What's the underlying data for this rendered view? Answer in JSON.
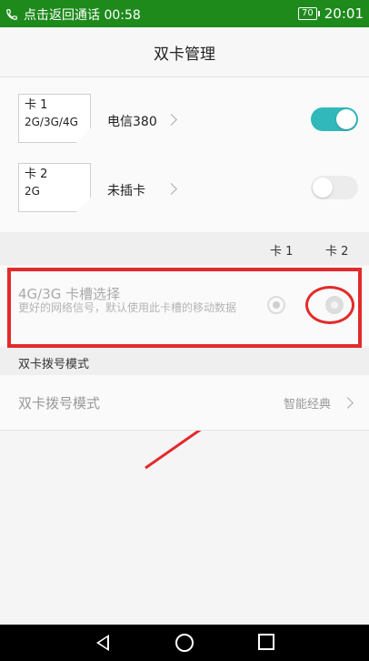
{
  "status_bar": {
    "left_text": "点击返回通话 00:58",
    "battery": "70",
    "time": "20:01"
  },
  "title": "双卡管理",
  "sims": [
    {
      "slot_label": "卡 1",
      "network": "2G/3G/4G",
      "name": "电信380",
      "enabled": true
    },
    {
      "slot_label": "卡 2",
      "network": "2G",
      "name": "未插卡",
      "enabled": false
    }
  ],
  "columns": {
    "card1": "卡 1",
    "card2": "卡 2"
  },
  "slot_select": {
    "title": "4G/3G 卡槽选择",
    "description": "更好的网络信号，默认使用此卡槽的移动数据",
    "selected": "卡 2"
  },
  "section_label": "双卡拨号模式",
  "dial_mode": {
    "title": "双卡拨号模式",
    "value": "智能经典"
  },
  "colors": {
    "status_bar": "#1e8a1c",
    "toggle_on": "#31b8ba",
    "annotation_red": "#e22b2b"
  }
}
